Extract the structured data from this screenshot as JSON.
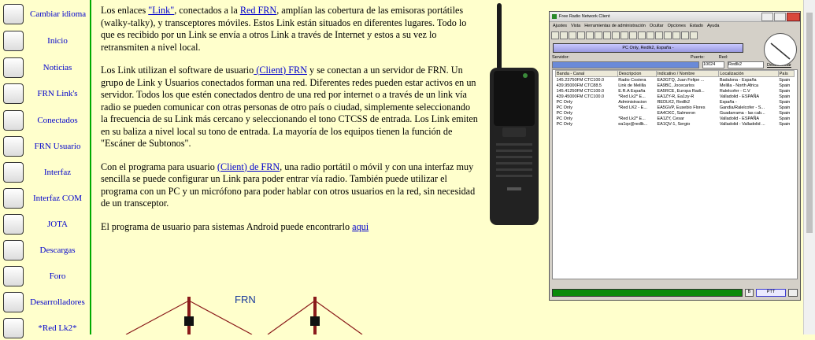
{
  "sidebar": {
    "items": [
      {
        "label": "Cambiar idioma",
        "icon": "flags-icon"
      },
      {
        "label": "Inicio",
        "icon": "home-icon"
      },
      {
        "label": "Noticias",
        "icon": "signpost-icon"
      },
      {
        "label": "FRN Link's",
        "icon": "antenna-icon"
      },
      {
        "label": "Conectados",
        "icon": "network-icon"
      },
      {
        "label": "FRN Usuario",
        "icon": "users-icon"
      },
      {
        "label": "Interfaz",
        "icon": "interface-icon"
      },
      {
        "label": "Interfaz COM",
        "icon": "com-interface-icon"
      },
      {
        "label": "JOTA",
        "icon": "scout-emblem-icon"
      },
      {
        "label": "Descargas",
        "icon": "download-icon"
      },
      {
        "label": "Foro",
        "icon": "forum-icon"
      },
      {
        "label": "Desarrolladores",
        "icon": "developers-icon"
      },
      {
        "label": "*Red Lk2*",
        "icon": "red-lk2-logo-icon"
      }
    ]
  },
  "content": {
    "p1_pre": "Los enlaces ",
    "p1_link1": "\"Link\"",
    "p1_mid": ", conectados a la ",
    "p1_link2": "Red FRN",
    "p1_post": ", amplían las cobertura de las emisoras portátiles (walky-talky), y transceptores móviles. Estos Link están situados en diferentes lugares. Todo lo que es recibido por un Link se envía a otros Link  a través de Internet y estos a su vez lo retransmiten a nivel local.",
    "p2_pre": "Los Link utilizan el software de usuario",
    "p2_link": " (Client) FRN",
    "p2_post": " y se conectan a un servidor de FRN. Un grupo de Link y Usuarios conectados forman una red. Diferentes redes pueden estar activos en un servidor. Todos los que estén conectados dentro de una red por internet o a través de un link vía radio se pueden comunicar con otras personas de otro país o ciudad, simplemente seleccionando la frecuencia de su Link más cercano y seleccionando el tono CTCSS de entrada. Los Link emiten en su baliza a nivel local su tono de entrada. La mayoría de los equipos tienen la función de \"Escáner de Subtonos\".",
    "p3_pre": "Con el programa para usuario ",
    "p3_link": "(Client) de FRN",
    "p3_post": ", una radio portátil o móvil y con una interfaz muy sencilla se puede configurar un Link para poder entrar vía radio. También puede utilizar el programa con un PC y un micrófono para poder hablar con otros usuarios en la red, sin necesidad de un transceptor.",
    "p4_pre": "El programa de usuario para sistemas Android puede encontrarlo ",
    "p4_link": "aqui"
  },
  "client_window": {
    "title": "Free Radio Network Client",
    "menu": [
      "Ajustes",
      "Vista",
      "Herramientas de administración",
      "Ocultar",
      "Opciones",
      "Estado",
      "Ayuda"
    ],
    "status": "PC Only, Redlk2, España -",
    "server_label": "Servidor:",
    "port_label": "Puerto:",
    "port_value": "10024",
    "net_label": "Red:",
    "net_value": "Redlk2",
    "disconnect": "Desconectar",
    "columns": [
      "Banda - Canal",
      "Descripcion",
      "Indicativo / Nombre",
      "Localización",
      "País"
    ],
    "rows": [
      [
        "145.23750FM CTC100.0",
        "Radio Costera",
        "EA3GTQ, Juan Felipe ...",
        "Badalona - España",
        "Spain"
      ],
      [
        "439.95000FM CTC88.5",
        "Link de Melilla",
        "EA9BC, Jocecarlos",
        "Melilla - North Africa",
        "Spain"
      ],
      [
        "145.41250FM CTC100.0",
        "E.R.A España",
        "EA5RCE, Europa Radi...",
        "Ralelcofer - C.V",
        "Spain"
      ],
      [
        "439.45000FM CTC100.0",
        "*Red Lk2* E...",
        "EA1ZY-R, Ea1zy-R",
        "Valladolid - ESPAÑA",
        "Spain"
      ],
      [
        "PC Only",
        "Administracion",
        "REDLK2, Redlk2",
        "España -",
        "Spain"
      ],
      [
        "PC Only",
        "*Red LK2 - E...",
        "EA5GVP, Eusebio Flores",
        "Gandia/Ralelcofer - S...",
        "Spain"
      ],
      [
        "PC Only",
        "",
        "EA4CKC, Salmeron",
        "Guadarrama - las cab...",
        "Spain"
      ],
      [
        "PC Only",
        "*Red Lk2* E...",
        "EA1ZY, Cesar",
        "Valladolid - ESPAÑA",
        "Spain"
      ],
      [
        "PC Only",
        "ea1qv@redlk...",
        "EA1QV-1, Sergio",
        "Valladolid - Valladolid ...",
        "Spain"
      ]
    ],
    "ptt": "PTT",
    "b_label": "B"
  },
  "diagram": {
    "label": "FRN"
  },
  "colors": {
    "page_bg": "#ffffcc",
    "link": "#0000cc",
    "sidebar_border": "#00aa00"
  }
}
